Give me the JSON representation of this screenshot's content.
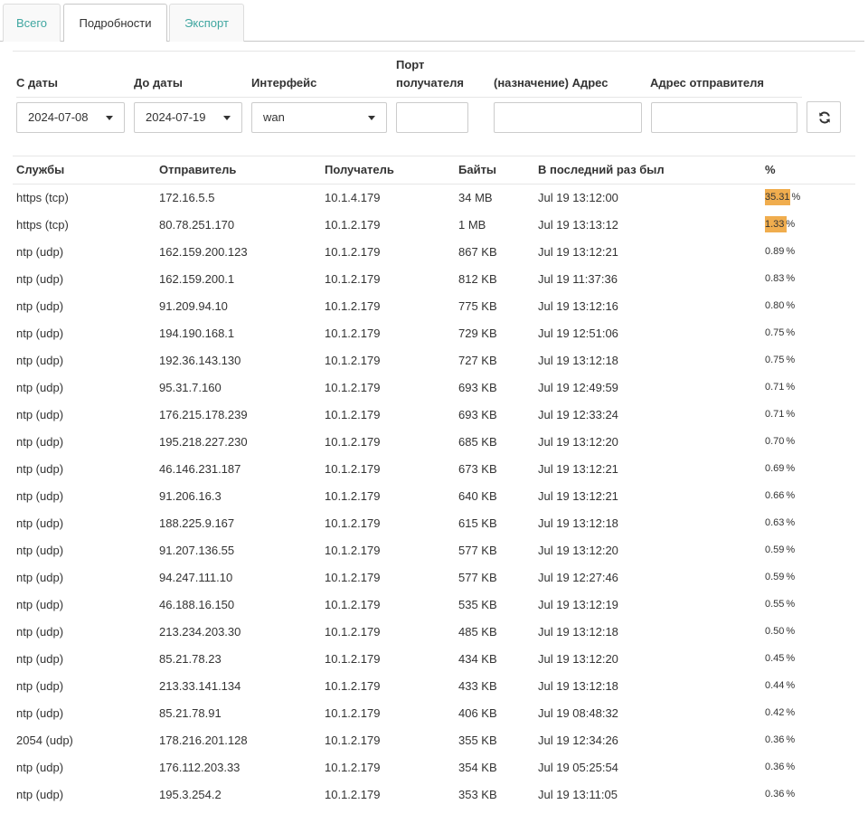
{
  "tabs": [
    {
      "label": "Всего",
      "active": false
    },
    {
      "label": "Подробности",
      "active": true
    },
    {
      "label": "Экспорт",
      "active": false
    }
  ],
  "filters": {
    "from_label": "С даты",
    "to_label": "До даты",
    "interface_label": "Интерфейс",
    "dst_port_label_1": "Порт",
    "dst_port_label_2": "получателя",
    "dst_addr_label": "(назначение) Адрес",
    "src_addr_label": "Адрес отправителя",
    "from_value": "2024-07-08",
    "to_value": "2024-07-19",
    "interface_value": "wan",
    "dst_port_value": "",
    "dst_addr_value": "",
    "src_addr_value": ""
  },
  "table": {
    "headers": [
      "Службы",
      "Отправитель",
      "Получатель",
      "Байты",
      "В последний раз был",
      "%"
    ],
    "rows": [
      {
        "service": "https (tcp)",
        "src": "172.16.5.5",
        "dst": "10.1.4.179",
        "bytes": "34 MB",
        "last_seen": "Jul 19 13:12:00",
        "pct": "35.31",
        "pct_value": 35.31
      },
      {
        "service": "https (tcp)",
        "src": "80.78.251.170",
        "dst": "10.1.2.179",
        "bytes": "1 MB",
        "last_seen": "Jul 19 13:13:12",
        "pct": "1.33",
        "pct_value": 1.33
      },
      {
        "service": "ntp (udp)",
        "src": "162.159.200.123",
        "dst": "10.1.2.179",
        "bytes": "867 KB",
        "last_seen": "Jul 19 13:12:21",
        "pct": "0.89",
        "pct_value": 0.89
      },
      {
        "service": "ntp (udp)",
        "src": "162.159.200.1",
        "dst": "10.1.2.179",
        "bytes": "812 KB",
        "last_seen": "Jul 19 11:37:36",
        "pct": "0.83",
        "pct_value": 0.83
      },
      {
        "service": "ntp (udp)",
        "src": "91.209.94.10",
        "dst": "10.1.2.179",
        "bytes": "775 KB",
        "last_seen": "Jul 19 13:12:16",
        "pct": "0.80",
        "pct_value": 0.8
      },
      {
        "service": "ntp (udp)",
        "src": "194.190.168.1",
        "dst": "10.1.2.179",
        "bytes": "729 KB",
        "last_seen": "Jul 19 12:51:06",
        "pct": "0.75",
        "pct_value": 0.75
      },
      {
        "service": "ntp (udp)",
        "src": "192.36.143.130",
        "dst": "10.1.2.179",
        "bytes": "727 KB",
        "last_seen": "Jul 19 13:12:18",
        "pct": "0.75",
        "pct_value": 0.75
      },
      {
        "service": "ntp (udp)",
        "src": "95.31.7.160",
        "dst": "10.1.2.179",
        "bytes": "693 KB",
        "last_seen": "Jul 19 12:49:59",
        "pct": "0.71",
        "pct_value": 0.71
      },
      {
        "service": "ntp (udp)",
        "src": "176.215.178.239",
        "dst": "10.1.2.179",
        "bytes": "693 KB",
        "last_seen": "Jul 19 12:33:24",
        "pct": "0.71",
        "pct_value": 0.71
      },
      {
        "service": "ntp (udp)",
        "src": "195.218.227.230",
        "dst": "10.1.2.179",
        "bytes": "685 KB",
        "last_seen": "Jul 19 13:12:20",
        "pct": "0.70",
        "pct_value": 0.7
      },
      {
        "service": "ntp (udp)",
        "src": "46.146.231.187",
        "dst": "10.1.2.179",
        "bytes": "673 KB",
        "last_seen": "Jul 19 13:12:21",
        "pct": "0.69",
        "pct_value": 0.69
      },
      {
        "service": "ntp (udp)",
        "src": "91.206.16.3",
        "dst": "10.1.2.179",
        "bytes": "640 KB",
        "last_seen": "Jul 19 13:12:21",
        "pct": "0.66",
        "pct_value": 0.66
      },
      {
        "service": "ntp (udp)",
        "src": "188.225.9.167",
        "dst": "10.1.2.179",
        "bytes": "615 KB",
        "last_seen": "Jul 19 13:12:18",
        "pct": "0.63",
        "pct_value": 0.63
      },
      {
        "service": "ntp (udp)",
        "src": "91.207.136.55",
        "dst": "10.1.2.179",
        "bytes": "577 KB",
        "last_seen": "Jul 19 13:12:20",
        "pct": "0.59",
        "pct_value": 0.59
      },
      {
        "service": "ntp (udp)",
        "src": "94.247.111.10",
        "dst": "10.1.2.179",
        "bytes": "577 KB",
        "last_seen": "Jul 19 12:27:46",
        "pct": "0.59",
        "pct_value": 0.59
      },
      {
        "service": "ntp (udp)",
        "src": "46.188.16.150",
        "dst": "10.1.2.179",
        "bytes": "535 KB",
        "last_seen": "Jul 19 13:12:19",
        "pct": "0.55",
        "pct_value": 0.55
      },
      {
        "service": "ntp (udp)",
        "src": "213.234.203.30",
        "dst": "10.1.2.179",
        "bytes": "485 KB",
        "last_seen": "Jul 19 13:12:18",
        "pct": "0.50",
        "pct_value": 0.5
      },
      {
        "service": "ntp (udp)",
        "src": "85.21.78.23",
        "dst": "10.1.2.179",
        "bytes": "434 KB",
        "last_seen": "Jul 19 13:12:20",
        "pct": "0.45",
        "pct_value": 0.45
      },
      {
        "service": "ntp (udp)",
        "src": "213.33.141.134",
        "dst": "10.1.2.179",
        "bytes": "433 KB",
        "last_seen": "Jul 19 13:12:18",
        "pct": "0.44",
        "pct_value": 0.44
      },
      {
        "service": "ntp (udp)",
        "src": "85.21.78.91",
        "dst": "10.1.2.179",
        "bytes": "406 KB",
        "last_seen": "Jul 19 08:48:32",
        "pct": "0.42",
        "pct_value": 0.42
      },
      {
        "service": "2054 (udp)",
        "src": "178.216.201.128",
        "dst": "10.1.2.179",
        "bytes": "355 KB",
        "last_seen": "Jul 19 12:34:26",
        "pct": "0.36",
        "pct_value": 0.36
      },
      {
        "service": "ntp (udp)",
        "src": "176.112.203.33",
        "dst": "10.1.2.179",
        "bytes": "354 KB",
        "last_seen": "Jul 19 05:25:54",
        "pct": "0.36",
        "pct_value": 0.36
      },
      {
        "service": "ntp (udp)",
        "src": "195.3.254.2",
        "dst": "10.1.2.179",
        "bytes": "353 KB",
        "last_seen": "Jul 19 13:11:05",
        "pct": "0.36",
        "pct_value": 0.36
      }
    ]
  },
  "pct_sign": "%",
  "colors": {
    "tab_link": "#3fa6a0",
    "percent_bar": "#f0ad4e"
  },
  "icons": {
    "refresh": "refresh-icon",
    "dropdown": "caret-down-icon"
  }
}
